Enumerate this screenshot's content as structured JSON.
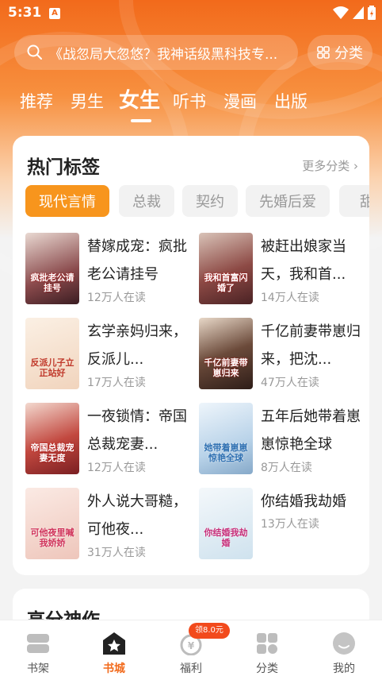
{
  "status_bar": {
    "time": "5:31",
    "notif_letter": "A"
  },
  "search": {
    "placeholder": "《战忽局大忽悠？我神话级黑科技专..."
  },
  "category_button": {
    "label": "分类"
  },
  "tabs": [
    {
      "label": "推荐"
    },
    {
      "label": "男生"
    },
    {
      "label": "女生"
    },
    {
      "label": "听书"
    },
    {
      "label": "漫画"
    },
    {
      "label": "出版"
    }
  ],
  "hot_tags": {
    "title": "热门标签",
    "more": "更多分类",
    "chips": [
      "现代言情",
      "总裁",
      "契约",
      "先婚后爱",
      "甜"
    ],
    "books": [
      {
        "title": "替嫁成宠：疯批老公请挂号",
        "readers": "12万人在读",
        "cover_text": "疯批老公请挂号",
        "cover_color": "#5b2a2e"
      },
      {
        "title": "被赶出娘家当天，我和首...",
        "readers": "14万人在读",
        "cover_text": "我和首富闪婚了",
        "cover_color": "#7a3b3b"
      },
      {
        "title": "玄学亲妈归来，反派儿...",
        "readers": "17万人在读",
        "cover_text": "反派儿子立正站好",
        "cover_color": "#f4e3cf"
      },
      {
        "title": "千亿前妻带崽归来，把沈...",
        "readers": "47万人在读",
        "cover_text": "千亿前妻带崽归来",
        "cover_color": "#3f2a22"
      },
      {
        "title": "一夜锁情：帝国总裁宠妻...",
        "readers": "12万人在读",
        "cover_text": "帝国总裁宠妻无度",
        "cover_color": "#b33a3a"
      },
      {
        "title": "五年后她带着崽崽惊艳全球",
        "readers": "8万人在读",
        "cover_text": "她带着崽崽惊艳全球",
        "cover_color": "#c8dff0"
      },
      {
        "title": "外人说大哥糙，可他夜...",
        "readers": "31万人在读",
        "cover_text": "可他夜里喊我娇娇",
        "cover_color": "#f0d6cf"
      },
      {
        "title": "你结婚我劫婚",
        "readers": "13万人在读",
        "cover_text": "你结婚我劫婚",
        "cover_color": "#dbe9f2"
      }
    ]
  },
  "section2": {
    "title": "高分神作"
  },
  "bottom_nav": [
    {
      "label": "书架"
    },
    {
      "label": "书城"
    },
    {
      "label": "福利"
    },
    {
      "label": "分类"
    },
    {
      "label": "我的"
    }
  ],
  "promo_badge": "领8.0元",
  "colors": {
    "accent": "#f26a1b",
    "chip_active": "#f7951d"
  }
}
